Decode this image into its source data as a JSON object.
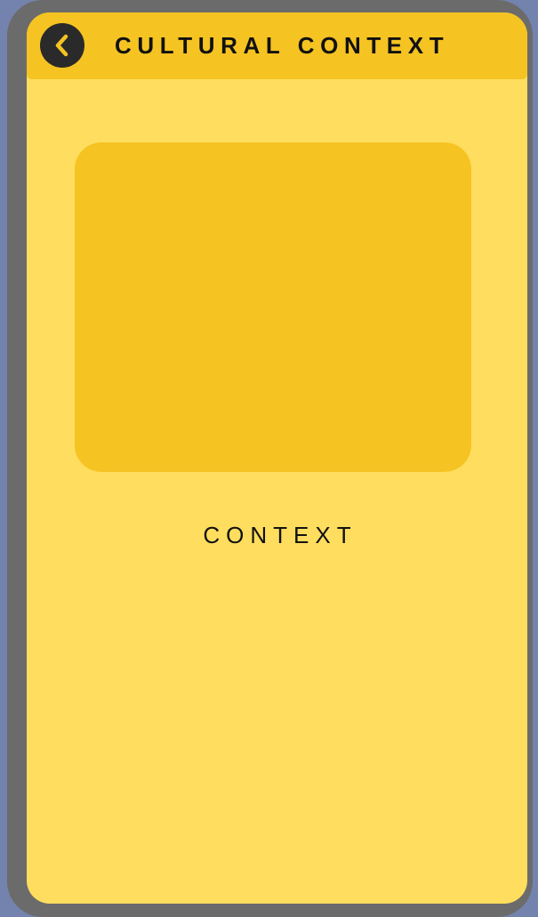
{
  "header": {
    "title": "CULTURAL CONTEXT",
    "back_icon": "chevron-left-icon"
  },
  "main": {
    "context_label": "CONTEXT"
  },
  "colors": {
    "background": "#7483ad",
    "device_frame": "#6b6b6b",
    "screen": "#ffdd5e",
    "accent": "#f5c322",
    "back_button": "#2a2a2a",
    "text": "#111111"
  }
}
